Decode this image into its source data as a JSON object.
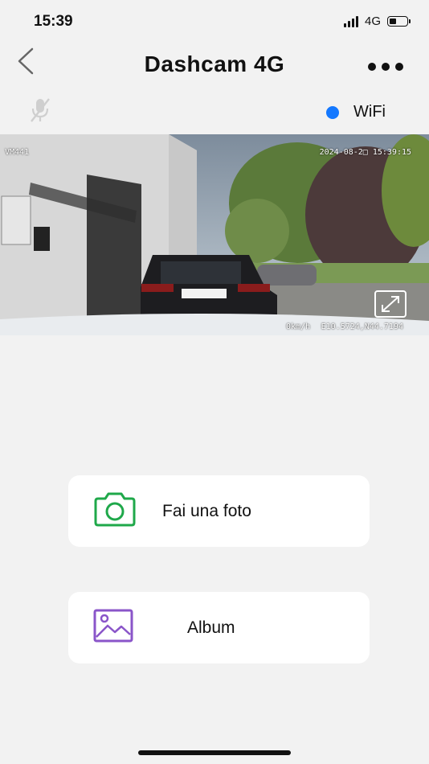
{
  "status_bar": {
    "time": "15:39",
    "network": "4G"
  },
  "header": {
    "title": "Dashcam 4G"
  },
  "connection": {
    "label": "WiFi",
    "color": "#1478ff"
  },
  "preview": {
    "device_id": "VM441",
    "datetime": "2024-08-2□ 15:39:15",
    "speed": "0km/h",
    "gps": "E10.5724,N44.7194"
  },
  "actions": {
    "photo": {
      "label": "Fai una foto",
      "icon": "camera-icon",
      "color": "#1fa84a"
    },
    "album": {
      "label": "Album",
      "icon": "image-icon",
      "color": "#8a55c9"
    }
  }
}
